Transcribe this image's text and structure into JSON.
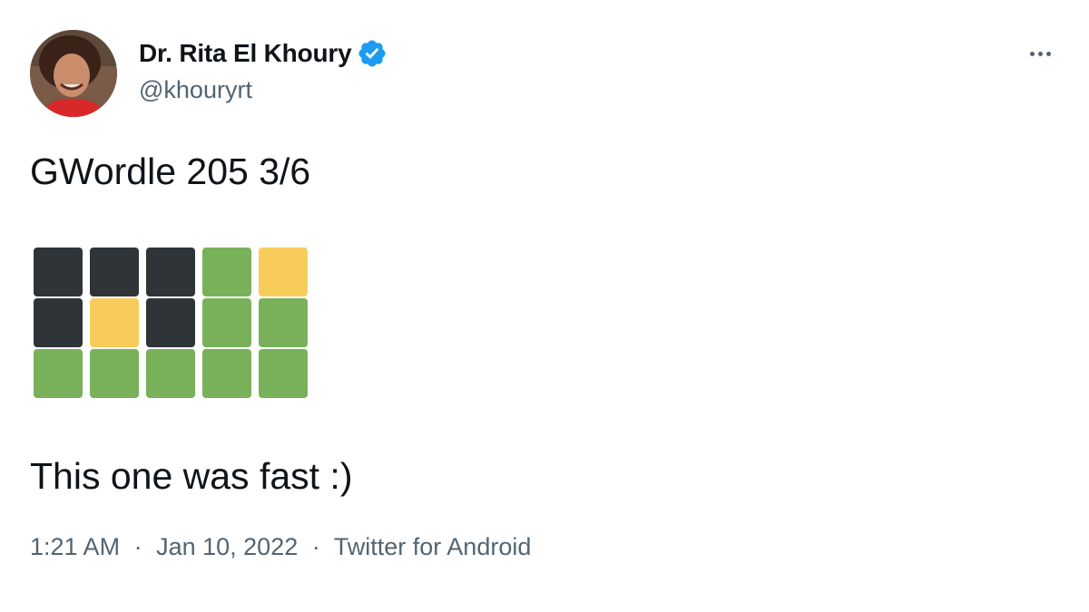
{
  "author": {
    "display_name": "Dr. Rita El Khoury",
    "handle": "@khouryrt",
    "verified": true,
    "verified_color": "#1d9bf0"
  },
  "tweet": {
    "line_1": "GWordle 205 3/6",
    "line_2": "This one was fast :)",
    "wordle_grid": [
      [
        "absent",
        "absent",
        "absent",
        "correct",
        "present"
      ],
      [
        "absent",
        "present",
        "absent",
        "correct",
        "correct"
      ],
      [
        "correct",
        "correct",
        "correct",
        "correct",
        "correct"
      ]
    ]
  },
  "tile_colors": {
    "absent": "#2f3439",
    "present": "#f7cc5b",
    "correct": "#78b159"
  },
  "meta": {
    "time": "1:21 AM",
    "separator": "·",
    "date": "Jan 10, 2022",
    "source": "Twitter for Android"
  },
  "icons": {
    "verified": "verified-badge-icon",
    "more": "more-options-icon"
  }
}
